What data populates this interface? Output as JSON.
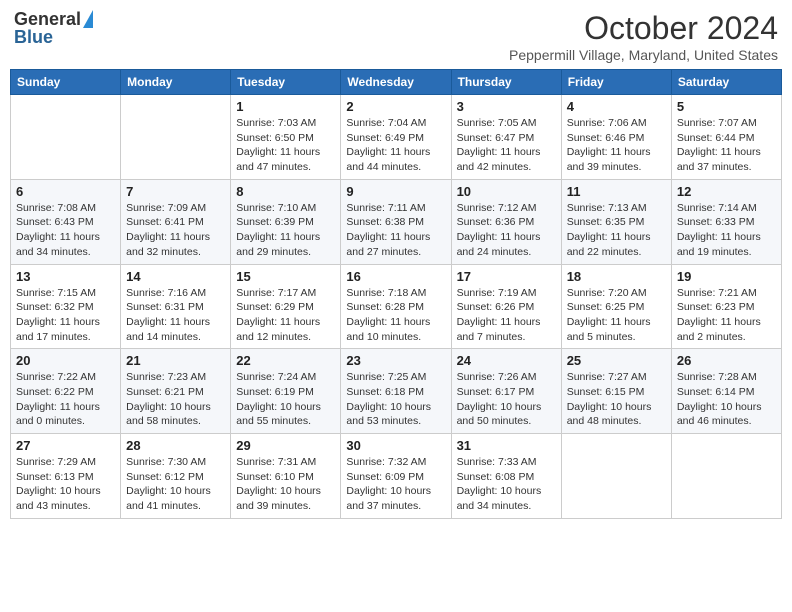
{
  "header": {
    "logo_general": "General",
    "logo_blue": "Blue",
    "month_title": "October 2024",
    "location": "Peppermill Village, Maryland, United States"
  },
  "days_of_week": [
    "Sunday",
    "Monday",
    "Tuesday",
    "Wednesday",
    "Thursday",
    "Friday",
    "Saturday"
  ],
  "weeks": [
    [
      {
        "day": "",
        "info": ""
      },
      {
        "day": "",
        "info": ""
      },
      {
        "day": "1",
        "info": "Sunrise: 7:03 AM\nSunset: 6:50 PM\nDaylight: 11 hours and 47 minutes."
      },
      {
        "day": "2",
        "info": "Sunrise: 7:04 AM\nSunset: 6:49 PM\nDaylight: 11 hours and 44 minutes."
      },
      {
        "day": "3",
        "info": "Sunrise: 7:05 AM\nSunset: 6:47 PM\nDaylight: 11 hours and 42 minutes."
      },
      {
        "day": "4",
        "info": "Sunrise: 7:06 AM\nSunset: 6:46 PM\nDaylight: 11 hours and 39 minutes."
      },
      {
        "day": "5",
        "info": "Sunrise: 7:07 AM\nSunset: 6:44 PM\nDaylight: 11 hours and 37 minutes."
      }
    ],
    [
      {
        "day": "6",
        "info": "Sunrise: 7:08 AM\nSunset: 6:43 PM\nDaylight: 11 hours and 34 minutes."
      },
      {
        "day": "7",
        "info": "Sunrise: 7:09 AM\nSunset: 6:41 PM\nDaylight: 11 hours and 32 minutes."
      },
      {
        "day": "8",
        "info": "Sunrise: 7:10 AM\nSunset: 6:39 PM\nDaylight: 11 hours and 29 minutes."
      },
      {
        "day": "9",
        "info": "Sunrise: 7:11 AM\nSunset: 6:38 PM\nDaylight: 11 hours and 27 minutes."
      },
      {
        "day": "10",
        "info": "Sunrise: 7:12 AM\nSunset: 6:36 PM\nDaylight: 11 hours and 24 minutes."
      },
      {
        "day": "11",
        "info": "Sunrise: 7:13 AM\nSunset: 6:35 PM\nDaylight: 11 hours and 22 minutes."
      },
      {
        "day": "12",
        "info": "Sunrise: 7:14 AM\nSunset: 6:33 PM\nDaylight: 11 hours and 19 minutes."
      }
    ],
    [
      {
        "day": "13",
        "info": "Sunrise: 7:15 AM\nSunset: 6:32 PM\nDaylight: 11 hours and 17 minutes."
      },
      {
        "day": "14",
        "info": "Sunrise: 7:16 AM\nSunset: 6:31 PM\nDaylight: 11 hours and 14 minutes."
      },
      {
        "day": "15",
        "info": "Sunrise: 7:17 AM\nSunset: 6:29 PM\nDaylight: 11 hours and 12 minutes."
      },
      {
        "day": "16",
        "info": "Sunrise: 7:18 AM\nSunset: 6:28 PM\nDaylight: 11 hours and 10 minutes."
      },
      {
        "day": "17",
        "info": "Sunrise: 7:19 AM\nSunset: 6:26 PM\nDaylight: 11 hours and 7 minutes."
      },
      {
        "day": "18",
        "info": "Sunrise: 7:20 AM\nSunset: 6:25 PM\nDaylight: 11 hours and 5 minutes."
      },
      {
        "day": "19",
        "info": "Sunrise: 7:21 AM\nSunset: 6:23 PM\nDaylight: 11 hours and 2 minutes."
      }
    ],
    [
      {
        "day": "20",
        "info": "Sunrise: 7:22 AM\nSunset: 6:22 PM\nDaylight: 11 hours and 0 minutes."
      },
      {
        "day": "21",
        "info": "Sunrise: 7:23 AM\nSunset: 6:21 PM\nDaylight: 10 hours and 58 minutes."
      },
      {
        "day": "22",
        "info": "Sunrise: 7:24 AM\nSunset: 6:19 PM\nDaylight: 10 hours and 55 minutes."
      },
      {
        "day": "23",
        "info": "Sunrise: 7:25 AM\nSunset: 6:18 PM\nDaylight: 10 hours and 53 minutes."
      },
      {
        "day": "24",
        "info": "Sunrise: 7:26 AM\nSunset: 6:17 PM\nDaylight: 10 hours and 50 minutes."
      },
      {
        "day": "25",
        "info": "Sunrise: 7:27 AM\nSunset: 6:15 PM\nDaylight: 10 hours and 48 minutes."
      },
      {
        "day": "26",
        "info": "Sunrise: 7:28 AM\nSunset: 6:14 PM\nDaylight: 10 hours and 46 minutes."
      }
    ],
    [
      {
        "day": "27",
        "info": "Sunrise: 7:29 AM\nSunset: 6:13 PM\nDaylight: 10 hours and 43 minutes."
      },
      {
        "day": "28",
        "info": "Sunrise: 7:30 AM\nSunset: 6:12 PM\nDaylight: 10 hours and 41 minutes."
      },
      {
        "day": "29",
        "info": "Sunrise: 7:31 AM\nSunset: 6:10 PM\nDaylight: 10 hours and 39 minutes."
      },
      {
        "day": "30",
        "info": "Sunrise: 7:32 AM\nSunset: 6:09 PM\nDaylight: 10 hours and 37 minutes."
      },
      {
        "day": "31",
        "info": "Sunrise: 7:33 AM\nSunset: 6:08 PM\nDaylight: 10 hours and 34 minutes."
      },
      {
        "day": "",
        "info": ""
      },
      {
        "day": "",
        "info": ""
      }
    ]
  ]
}
